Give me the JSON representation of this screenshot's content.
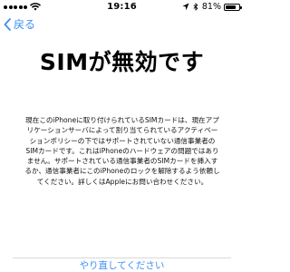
{
  "status_bar": {
    "time": "19:16",
    "battery_text": "81%",
    "battery_level": 0.81,
    "icons": [
      "signal-icon",
      "wifi-icon",
      "location-icon",
      "bluetooth-icon",
      "battery-icon"
    ]
  },
  "nav": {
    "back_label": "戻る"
  },
  "title": "SIMが無効です",
  "description": "現在このiPhoneに取り付けられているSIMカードは、現在アプリケーションサーバによって割り当てられているアクティベーションポリシーの下ではサポートされていない通信事業者のSIMカードです。これはiPhoneのハードウェアの問題ではありません。サポートされている通信事業者のSIMカードを挿入するか、通信事業者にこのiPhoneのロックを解除するよう依頼してください。詳しくはAppleにお問い合わせください。",
  "actions": {
    "retry_label": "やり直してください"
  },
  "colors": {
    "accent": "#3d8ef6",
    "background": "#ffffff",
    "text": "#000000",
    "divider": "#d8d8d8"
  }
}
